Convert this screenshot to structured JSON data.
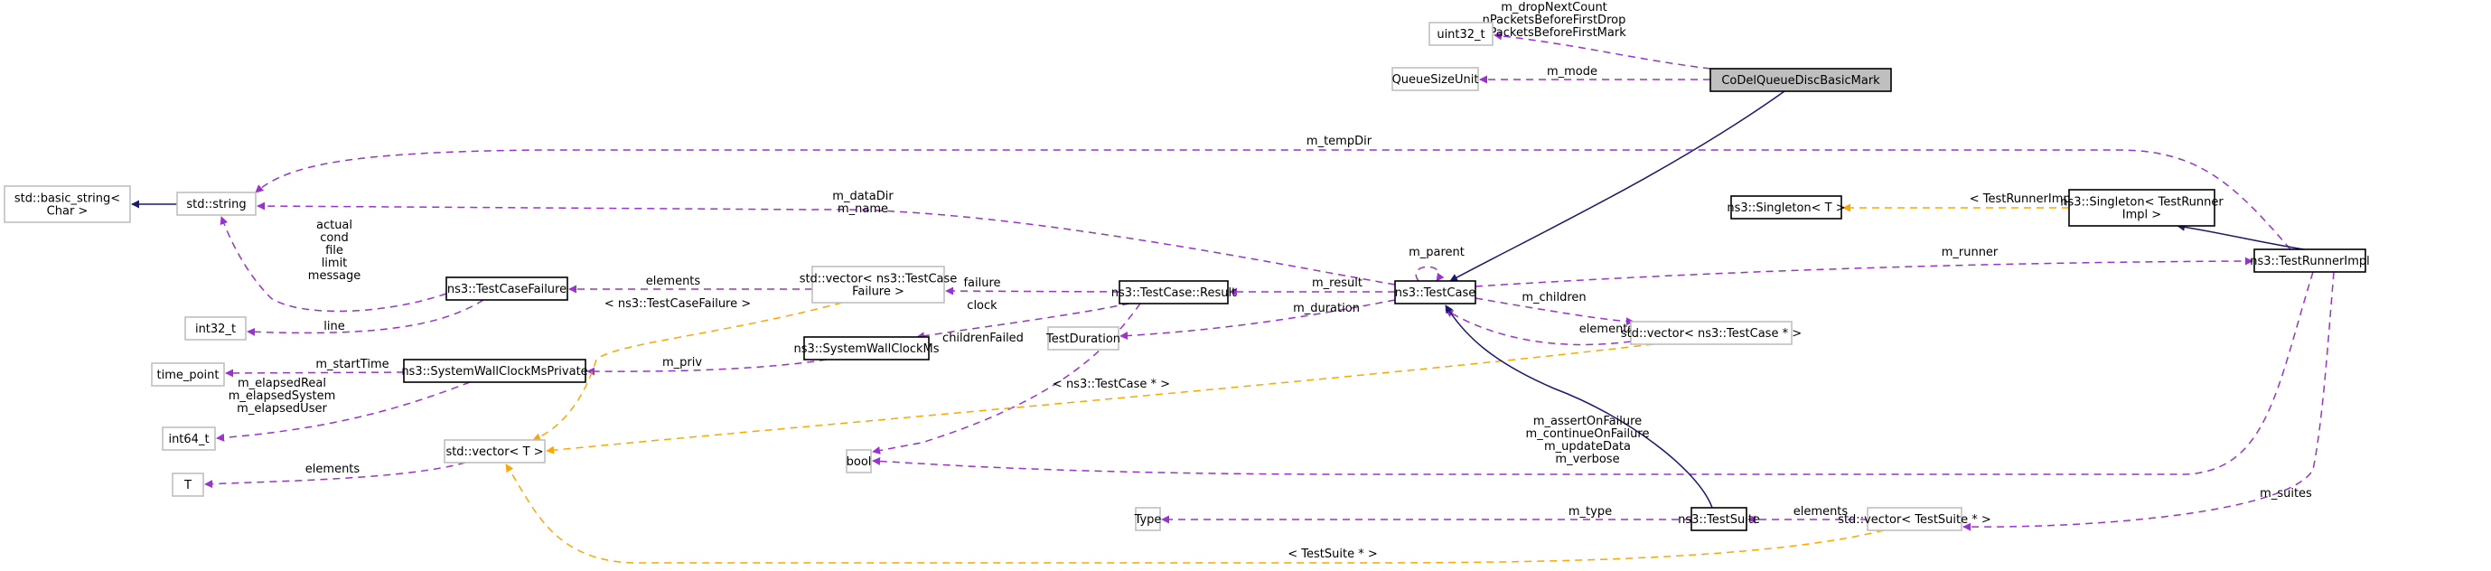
{
  "colors": {
    "usage": "#9a32cd",
    "template": "#ffa500",
    "inherit": "#191970",
    "focus_fill": "#bfbfbf"
  },
  "nodes": [
    {
      "id": "uint32",
      "label": [
        "uint32_t"
      ],
      "kind": "external"
    },
    {
      "id": "queuesizeunit",
      "label": [
        "QueueSizeUnit"
      ],
      "kind": "external"
    },
    {
      "id": "codel",
      "label": [
        "CoDelQueueDiscBasicMark"
      ],
      "kind": "focus"
    },
    {
      "id": "basic_string",
      "label": [
        "std::basic_string<",
        "Char >"
      ],
      "kind": "external"
    },
    {
      "id": "string",
      "label": [
        "std::string"
      ],
      "kind": "external"
    },
    {
      "id": "singleton_t",
      "label": [
        "ns3::Singleton< T >"
      ],
      "kind": "doc"
    },
    {
      "id": "singleton_tri",
      "label": [
        "ns3::Singleton< TestRunner",
        "Impl >"
      ],
      "kind": "doc"
    },
    {
      "id": "testcasefailure",
      "label": [
        "ns3::TestCaseFailure"
      ],
      "kind": "doc"
    },
    {
      "id": "vec_tcf",
      "label": [
        "std::vector< ns3::TestCase",
        "Failure >"
      ],
      "kind": "external"
    },
    {
      "id": "result",
      "label": [
        "ns3::TestCase::Result"
      ],
      "kind": "doc"
    },
    {
      "id": "testcase",
      "label": [
        "ns3::TestCase"
      ],
      "kind": "doc"
    },
    {
      "id": "testrunnerimpl",
      "label": [
        "ns3::TestRunnerImpl"
      ],
      "kind": "doc"
    },
    {
      "id": "int32",
      "label": [
        "int32_t"
      ],
      "kind": "external"
    },
    {
      "id": "swcms",
      "label": [
        "ns3::SystemWallClockMs"
      ],
      "kind": "doc"
    },
    {
      "id": "testduration",
      "label": [
        "TestDuration"
      ],
      "kind": "external"
    },
    {
      "id": "vec_tc",
      "label": [
        "std::vector< ns3::TestCase * >"
      ],
      "kind": "external"
    },
    {
      "id": "time_point",
      "label": [
        "time_point"
      ],
      "kind": "external"
    },
    {
      "id": "swcmsp",
      "label": [
        "ns3::SystemWallClockMsPrivate"
      ],
      "kind": "doc"
    },
    {
      "id": "int64",
      "label": [
        "int64_t"
      ],
      "kind": "external"
    },
    {
      "id": "vec_t",
      "label": [
        "std::vector< T >"
      ],
      "kind": "external"
    },
    {
      "id": "bool",
      "label": [
        "bool"
      ],
      "kind": "external"
    },
    {
      "id": "T",
      "label": [
        "T"
      ],
      "kind": "external"
    },
    {
      "id": "type",
      "label": [
        "Type"
      ],
      "kind": "external"
    },
    {
      "id": "testsuite",
      "label": [
        "ns3::TestSuite"
      ],
      "kind": "doc"
    },
    {
      "id": "vec_ts",
      "label": [
        "std::vector< TestSuite * >"
      ],
      "kind": "external"
    }
  ],
  "edges": [
    {
      "id": "e1",
      "from": "codel",
      "to": "uint32",
      "kind": "usage",
      "label": [
        "m_dropNextCount",
        "nPacketsBeforeFirstDrop",
        "nPacketsBeforeFirstMark"
      ]
    },
    {
      "id": "e2",
      "from": "codel",
      "to": "queuesizeunit",
      "kind": "usage",
      "label": [
        "m_mode"
      ]
    },
    {
      "id": "e3",
      "from": "codel",
      "to": "testcase",
      "kind": "inherit",
      "label": []
    },
    {
      "id": "e4",
      "from": "string",
      "to": "basic_string",
      "kind": "inherit",
      "label": []
    },
    {
      "id": "e5",
      "from": "testrunnerimpl",
      "to": "string",
      "kind": "usage",
      "label": [
        "m_tempDir"
      ]
    },
    {
      "id": "e6",
      "from": "testcase",
      "to": "string",
      "kind": "usage",
      "label": [
        "m_dataDir",
        "m_name"
      ]
    },
    {
      "id": "e7",
      "from": "testcasefailure",
      "to": "string",
      "kind": "usage",
      "label": [
        "actual",
        "cond",
        "file",
        "limit",
        "message"
      ]
    },
    {
      "id": "e8",
      "from": "testcasefailure",
      "to": "int32",
      "kind": "usage",
      "label": [
        "line"
      ]
    },
    {
      "id": "e9",
      "from": "vec_tcf",
      "to": "testcasefailure",
      "kind": "usage",
      "label": [
        "elements"
      ]
    },
    {
      "id": "e10",
      "from": "result",
      "to": "vec_tcf",
      "kind": "usage",
      "label": [
        "failure"
      ]
    },
    {
      "id": "e11",
      "from": "result",
      "to": "swcms",
      "kind": "usage",
      "label": [
        "clock"
      ]
    },
    {
      "id": "e12",
      "from": "result",
      "to": "bool",
      "kind": "usage",
      "label": [
        "childrenFailed"
      ]
    },
    {
      "id": "e13",
      "from": "testcase",
      "to": "result",
      "kind": "usage",
      "label": [
        "m_result"
      ]
    },
    {
      "id": "e14",
      "from": "testcase",
      "to": "testduration",
      "kind": "usage",
      "label": [
        "m_duration"
      ]
    },
    {
      "id": "e15",
      "from": "testcase",
      "to": "testcase",
      "kind": "usage",
      "label": [
        "m_parent"
      ]
    },
    {
      "id": "e16",
      "from": "testcase",
      "to": "testrunnerimpl",
      "kind": "usage",
      "label": [
        "m_runner"
      ]
    },
    {
      "id": "e17",
      "from": "testcase",
      "to": "vec_tc",
      "kind": "usage",
      "label": [
        "m_children"
      ]
    },
    {
      "id": "e18",
      "from": "vec_tc",
      "to": "testcase",
      "kind": "usage",
      "label": [
        "elements"
      ]
    },
    {
      "id": "e19",
      "from": "singleton_tri",
      "to": "singleton_t",
      "kind": "template",
      "label": [
        "< TestRunnerImpl >"
      ]
    },
    {
      "id": "e20",
      "from": "testrunnerimpl",
      "to": "singleton_tri",
      "kind": "inherit",
      "label": []
    },
    {
      "id": "e21",
      "from": "swcms",
      "to": "swcmsp",
      "kind": "usage",
      "label": [
        "m_priv"
      ]
    },
    {
      "id": "e22",
      "from": "swcmsp",
      "to": "time_point",
      "kind": "usage",
      "label": [
        "m_startTime"
      ]
    },
    {
      "id": "e23",
      "from": "swcmsp",
      "to": "int64",
      "kind": "usage",
      "label": [
        "m_elapsedReal",
        "m_elapsedSystem",
        "m_elapsedUser"
      ]
    },
    {
      "id": "e24",
      "from": "vec_tcf",
      "to": "vec_t",
      "kind": "template",
      "label": [
        "< ns3::TestCaseFailure >"
      ]
    },
    {
      "id": "e25",
      "from": "vec_tc",
      "to": "vec_t",
      "kind": "template",
      "label": [
        "< ns3::TestCase * >"
      ]
    },
    {
      "id": "e26",
      "from": "vec_t",
      "to": "T",
      "kind": "usage",
      "label": [
        "elements"
      ]
    },
    {
      "id": "e27",
      "from": "testrunnerimpl",
      "to": "bool",
      "kind": "usage",
      "label": [
        "m_assertOnFailure",
        "m_continueOnFailure",
        "m_updateData",
        "m_verbose"
      ]
    },
    {
      "id": "e28",
      "from": "testsuite",
      "to": "testcase",
      "kind": "inherit",
      "label": []
    },
    {
      "id": "e29",
      "from": "testsuite",
      "to": "type",
      "kind": "usage",
      "label": [
        "m_type"
      ]
    },
    {
      "id": "e30",
      "from": "vec_ts",
      "to": "testsuite",
      "kind": "usage",
      "label": [
        "elements"
      ]
    },
    {
      "id": "e31",
      "from": "testrunnerimpl",
      "to": "vec_ts",
      "kind": "usage",
      "label": [
        "m_suites"
      ]
    },
    {
      "id": "e32",
      "from": "vec_ts",
      "to": "vec_t",
      "kind": "template",
      "label": [
        "< TestSuite * >"
      ]
    }
  ]
}
